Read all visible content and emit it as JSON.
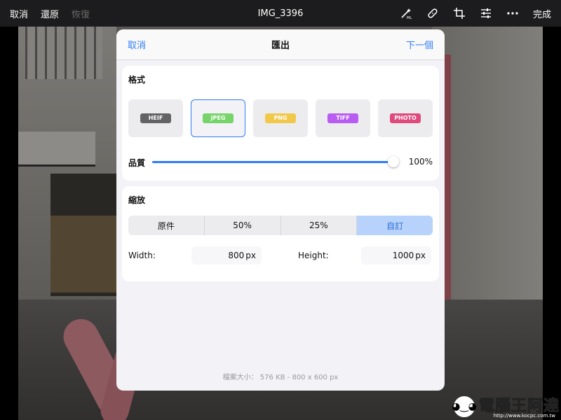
{
  "topbar": {
    "cancel": "取消",
    "undo": "還原",
    "redo": "恢復",
    "title": "IMG_3396",
    "done": "完成",
    "tools": [
      "magic-ml-icon",
      "bandage-icon",
      "crop-icon",
      "sliders-icon",
      "more-icon"
    ]
  },
  "dialog": {
    "cancel": "取消",
    "title": "匯出",
    "next": "下一個",
    "format": {
      "heading": "格式",
      "options": [
        {
          "label": "HEIF",
          "color": "#636366"
        },
        {
          "label": "JPEG",
          "color": "#77d46a"
        },
        {
          "label": "PNG",
          "color": "#f2c84b"
        },
        {
          "label": "TIFF",
          "color": "#b85cf2"
        },
        {
          "label": "PHOTO",
          "color": "#e0497b"
        }
      ],
      "selected": "JPEG",
      "quality_label": "品質",
      "quality_value": "100%",
      "quality_level": 1.0
    },
    "scale": {
      "heading": "縮放",
      "options": [
        "原件",
        "50%",
        "25%",
        "自訂"
      ],
      "selected": "自訂",
      "width_label": "Width:",
      "width_value": "800",
      "height_label": "Height:",
      "height_value": "1000",
      "unit": "px"
    },
    "file_info": "檔案大小： 576 KB - 800 x 600 px"
  },
  "watermark": {
    "text": "電腦王阿達",
    "url": "http://www.kocpc.com.tw"
  },
  "colors": {
    "accent": "#2f7ef5",
    "topbar_bg": "#1c1c1e",
    "segment_active_bg": "#b7d2fb"
  }
}
